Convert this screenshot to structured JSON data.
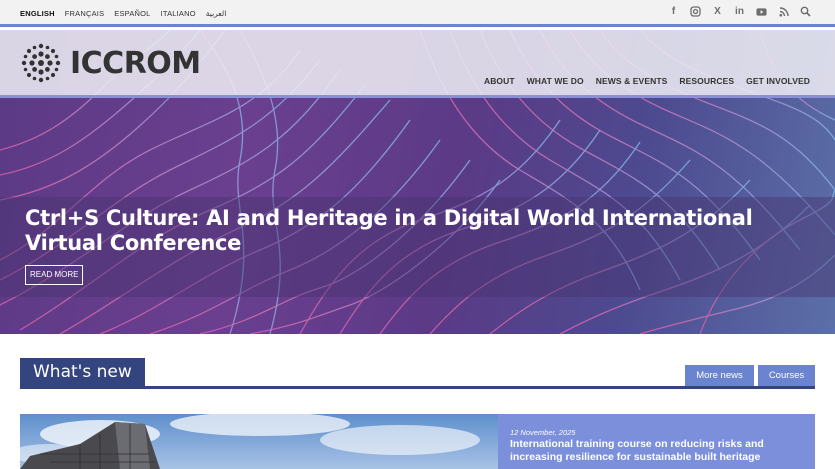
{
  "languages": {
    "items": [
      {
        "label": "ENGLISH",
        "active": true
      },
      {
        "label": "FRANÇAIS",
        "active": false
      },
      {
        "label": "ESPAÑOL",
        "active": false
      },
      {
        "label": "ITALIANO",
        "active": false
      },
      {
        "label": "العربية",
        "active": false
      }
    ]
  },
  "social": {
    "icons": [
      "facebook-icon",
      "instagram-icon",
      "x-icon",
      "linkedin-icon",
      "youtube-icon",
      "rss-icon",
      "search-icon"
    ],
    "glyphs": {
      "facebook": "f",
      "linkedin": "in",
      "x": "X"
    }
  },
  "header": {
    "logo_text": "ICCROM",
    "nav": [
      "ABOUT",
      "WHAT WE DO",
      "NEWS & EVENTS",
      "RESOURCES",
      "GET INVOLVED"
    ]
  },
  "hero": {
    "title": "Ctrl+S Culture: AI and Heritage in a Digital World International Virtual Conference",
    "read_more": "READ MORE"
  },
  "whats_new": {
    "title": "What's new",
    "more_news": "More news",
    "courses": "Courses"
  },
  "feature": {
    "date": "12 November, 2025",
    "title": "International training course on reducing risks and increasing resilience for sustainable built heritage"
  },
  "colors": {
    "accent": "#6b84cf",
    "dark_navy": "#33447e",
    "hero_purple": "#5c3a85",
    "card_panel": "#7b8fdb"
  }
}
